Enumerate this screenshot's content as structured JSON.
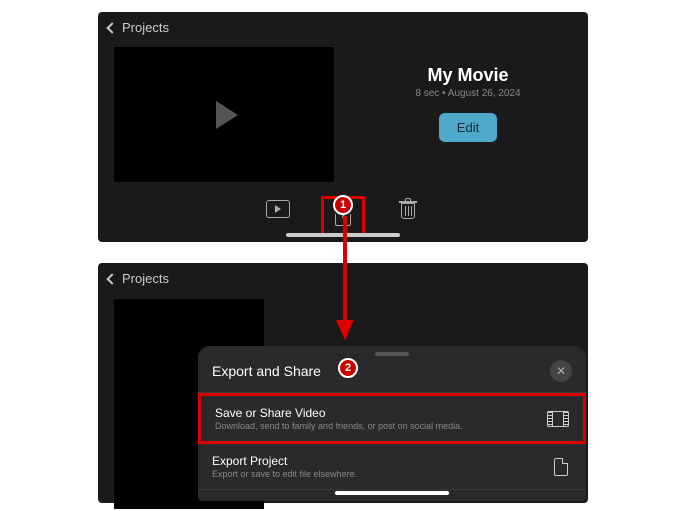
{
  "nav": {
    "back_label": "Projects"
  },
  "movie": {
    "title": "My Movie",
    "meta": "8 sec • August 26, 2024",
    "edit_label": "Edit"
  },
  "sheet": {
    "title": "Export and Share",
    "rows": [
      {
        "title": "Save or Share Video",
        "subtitle": "Download, send to family and friends, or post on social media."
      },
      {
        "title": "Export Project",
        "subtitle": "Export or save to edit file elsewhere."
      }
    ]
  },
  "annotations": {
    "step1": "1",
    "step2": "2"
  }
}
